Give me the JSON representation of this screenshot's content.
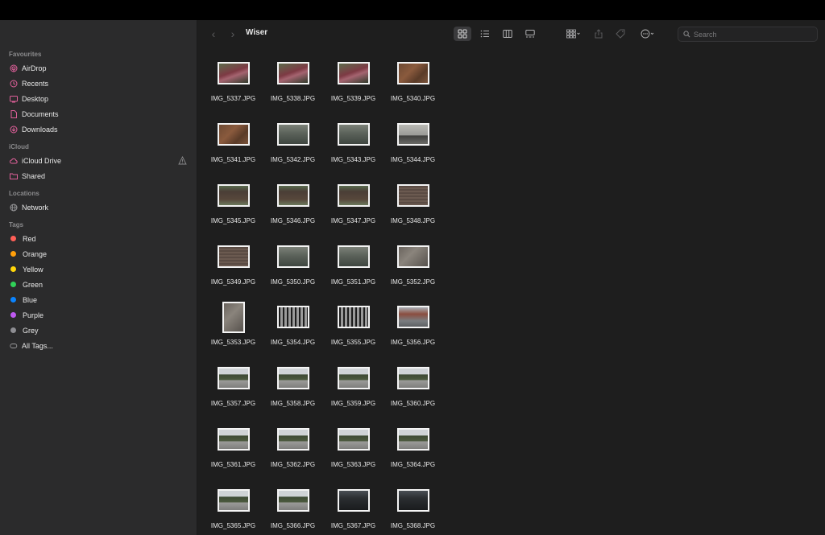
{
  "window": {
    "title": "Wiser"
  },
  "sidebar": {
    "favourites_heading": "Favourites",
    "favourites": [
      {
        "label": "AirDrop",
        "icon": "airdrop-icon"
      },
      {
        "label": "Recents",
        "icon": "clock-icon"
      },
      {
        "label": "Desktop",
        "icon": "desktop-icon"
      },
      {
        "label": "Documents",
        "icon": "document-icon"
      },
      {
        "label": "Downloads",
        "icon": "download-icon"
      }
    ],
    "icloud_heading": "iCloud",
    "icloud": [
      {
        "label": "iCloud Drive",
        "icon": "cloud-icon"
      },
      {
        "label": "Shared",
        "icon": "shared-folder-icon"
      }
    ],
    "locations_heading": "Locations",
    "locations": [
      {
        "label": "Network",
        "icon": "network-icon"
      }
    ],
    "tags_heading": "Tags",
    "tags": [
      {
        "label": "Red",
        "color": "#ff5f57"
      },
      {
        "label": "Orange",
        "color": "#ff9f0a"
      },
      {
        "label": "Yellow",
        "color": "#ffd60a"
      },
      {
        "label": "Green",
        "color": "#30d158"
      },
      {
        "label": "Blue",
        "color": "#0a84ff"
      },
      {
        "label": "Purple",
        "color": "#bf5af2"
      },
      {
        "label": "Grey",
        "color": "#8e8e93"
      }
    ],
    "all_tags": "All Tags..."
  },
  "search": {
    "placeholder": "Search"
  },
  "files": [
    {
      "name": "IMG_5337.JPG",
      "tone": "flowers",
      "shape": "wide"
    },
    {
      "name": "IMG_5338.JPG",
      "tone": "flowers",
      "shape": "wide"
    },
    {
      "name": "IMG_5339.JPG",
      "tone": "flowers",
      "shape": "wide"
    },
    {
      "name": "IMG_5340.JPG",
      "tone": "leaves",
      "shape": "wide"
    },
    {
      "name": "IMG_5341.JPG",
      "tone": "leaves",
      "shape": "wide"
    },
    {
      "name": "IMG_5342.JPG",
      "tone": "bench",
      "shape": "wide"
    },
    {
      "name": "IMG_5343.JPG",
      "tone": "bench",
      "shape": "wide"
    },
    {
      "name": "IMG_5344.JPG",
      "tone": "wall",
      "shape": "wide"
    },
    {
      "name": "IMG_5345.JPG",
      "tone": "plaque",
      "shape": "wide"
    },
    {
      "name": "IMG_5346.JPG",
      "tone": "plaque",
      "shape": "wide"
    },
    {
      "name": "IMG_5347.JPG",
      "tone": "plaque",
      "shape": "wide"
    },
    {
      "name": "IMG_5348.JPG",
      "tone": "brown",
      "shape": "wide"
    },
    {
      "name": "IMG_5349.JPG",
      "tone": "brown",
      "shape": "wide"
    },
    {
      "name": "IMG_5350.JPG",
      "tone": "bench",
      "shape": "wide"
    },
    {
      "name": "IMG_5351.JPG",
      "tone": "bench",
      "shape": "wide"
    },
    {
      "name": "IMG_5352.JPG",
      "tone": "gravel",
      "shape": "wide"
    },
    {
      "name": "IMG_5353.JPG",
      "tone": "gravel",
      "shape": "tall"
    },
    {
      "name": "IMG_5354.JPG",
      "tone": "gate",
      "shape": "wide"
    },
    {
      "name": "IMG_5355.JPG",
      "tone": "gate",
      "shape": "wide"
    },
    {
      "name": "IMG_5356.JPG",
      "tone": "street",
      "shape": "wide"
    },
    {
      "name": "IMG_5357.JPG",
      "tone": "park",
      "shape": "wide"
    },
    {
      "name": "IMG_5358.JPG",
      "tone": "park",
      "shape": "wide"
    },
    {
      "name": "IMG_5359.JPG",
      "tone": "park",
      "shape": "wide"
    },
    {
      "name": "IMG_5360.JPG",
      "tone": "park",
      "shape": "wide"
    },
    {
      "name": "IMG_5361.JPG",
      "tone": "park",
      "shape": "wide"
    },
    {
      "name": "IMG_5362.JPG",
      "tone": "park",
      "shape": "wide"
    },
    {
      "name": "IMG_5363.JPG",
      "tone": "park",
      "shape": "wide"
    },
    {
      "name": "IMG_5364.JPG",
      "tone": "park",
      "shape": "wide"
    },
    {
      "name": "IMG_5365.JPG",
      "tone": "park",
      "shape": "wide"
    },
    {
      "name": "IMG_5366.JPG",
      "tone": "park",
      "shape": "wide"
    },
    {
      "name": "IMG_5367.JPG",
      "tone": "night",
      "shape": "wide"
    },
    {
      "name": "IMG_5368.JPG",
      "tone": "night",
      "shape": "wide"
    }
  ]
}
